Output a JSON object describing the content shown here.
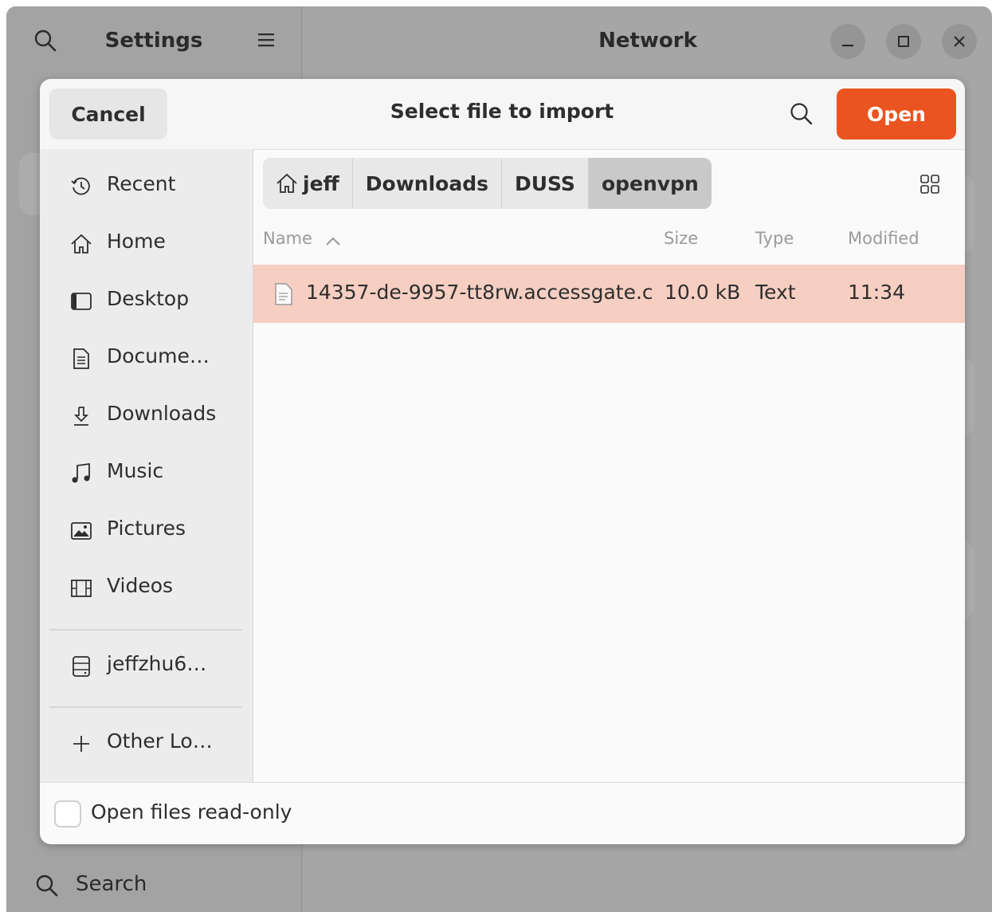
{
  "settings_window": {
    "sidebar_title": "Settings",
    "main_title": "Network",
    "footer_search": "Search",
    "icons": {
      "search": "search-icon",
      "menu": "hamburger-menu-icon",
      "minimize": "minimize-icon",
      "maximize": "maximize-icon",
      "close": "close-icon"
    }
  },
  "dialog": {
    "title": "Select file to import",
    "cancel_label": "Cancel",
    "open_label": "Open",
    "accent_color": "#e95420",
    "places": [
      {
        "label": "Recent",
        "icon": "clock-icon"
      },
      {
        "label": "Home",
        "icon": "home-icon"
      },
      {
        "label": "Desktop",
        "icon": "desktop-icon"
      },
      {
        "label": "Docume…",
        "icon": "document-icon"
      },
      {
        "label": "Downloads",
        "icon": "download-icon"
      },
      {
        "label": "Music",
        "icon": "music-icon"
      },
      {
        "label": "Pictures",
        "icon": "picture-icon"
      },
      {
        "label": "Videos",
        "icon": "video-icon"
      }
    ],
    "network_place": {
      "label": "jeffzhu6…",
      "icon": "server-icon"
    },
    "other_locations": {
      "label": "Other Lo…",
      "icon": "plus-icon"
    },
    "path": [
      {
        "label": "jeff",
        "icon": "home-icon"
      },
      {
        "label": "Downloads"
      },
      {
        "label": "DUSS"
      },
      {
        "label": "openvpn",
        "active": true
      }
    ],
    "columns": {
      "name": "Name",
      "size": "Size",
      "type": "Type",
      "modified": "Modified"
    },
    "files": [
      {
        "name": "14357-de-9957-tt8rw.accessgate.c",
        "size": "10.0 kB",
        "type": "Text",
        "modified": "11:34",
        "selected": true
      }
    ],
    "read_only_label": "Open files read-only",
    "read_only_checked": false
  }
}
